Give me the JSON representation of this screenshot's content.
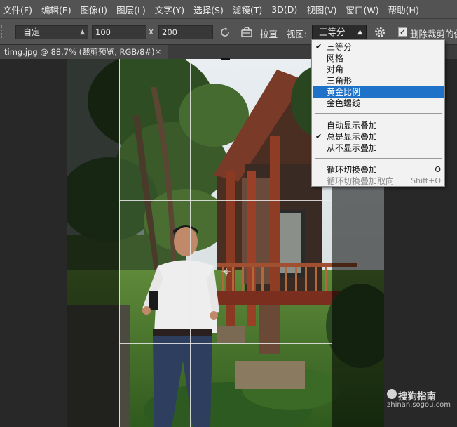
{
  "menubar": {
    "items": [
      "文件(F)",
      "编辑(E)",
      "图像(I)",
      "图层(L)",
      "文字(Y)",
      "选择(S)",
      "滤镜(T)",
      "3D(D)",
      "视图(V)",
      "窗口(W)",
      "帮助(H)"
    ]
  },
  "options": {
    "ratio_preset": "自定",
    "width": "100",
    "x_sep": "x",
    "height": "200",
    "straighten_label": "拉直",
    "view_label": "视图:",
    "view_value": "三等分",
    "delete_cropped_label": "删除裁剪的像",
    "delete_cropped_checked": true
  },
  "tab": {
    "title": "timg.jpg @ 88.7% (裁剪预览, RGB/8#)",
    "close": "×"
  },
  "view_menu": {
    "items": [
      {
        "label": "三等分",
        "checked": true
      },
      {
        "label": "网格"
      },
      {
        "label": "对角"
      },
      {
        "label": "三角形"
      },
      {
        "label": "黄金比例",
        "highlighted": true
      },
      {
        "label": "金色螺线"
      },
      {
        "label": "自动显示叠加"
      },
      {
        "label": "总是显示叠加",
        "checked": true
      },
      {
        "label": "从不显示叠加"
      },
      {
        "label": "循环切换叠加",
        "shortcut": "O"
      },
      {
        "label": "循环切换叠加取向",
        "shortcut": "Shift+O",
        "disabled": true
      }
    ],
    "check_mark": "✔"
  },
  "watermark": {
    "title": "搜狗指南",
    "subtitle": "zhinan.sogou.com"
  },
  "colors": {
    "menu_bg": "#535353",
    "highlight": "#1e72c8",
    "canvas_bg": "#282828"
  }
}
